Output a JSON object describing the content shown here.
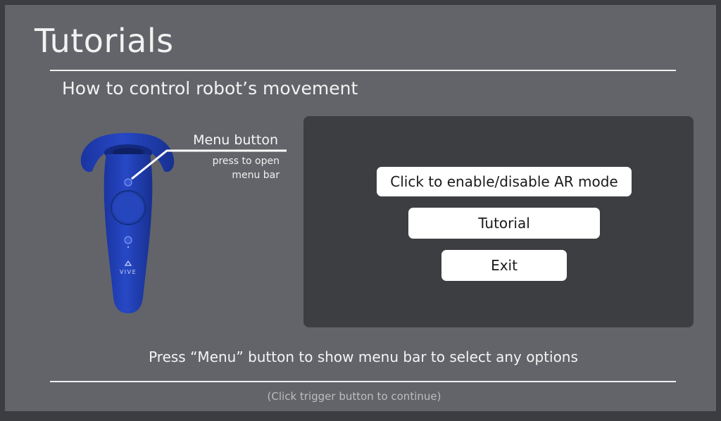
{
  "page": {
    "title": "Tutorials",
    "subtitle": "How to control robot’s movement"
  },
  "controller": {
    "icon": "vive-controller-icon",
    "brand_text": "VIVE",
    "color": "#1f3fb0",
    "menu_label": "Menu button",
    "menu_desc_line1": "press to open",
    "menu_desc_line2": "menu bar"
  },
  "menu": {
    "ar_button_label": "Click to enable/disable AR mode",
    "tutorial_button_label": "Tutorial",
    "exit_button_label": "Exit"
  },
  "footer": {
    "instruction": "Press “Menu” button to show menu bar to select any options",
    "hint": "(Click trigger button to continue)"
  },
  "colors": {
    "background": "#626469",
    "panel": "#3d3e42",
    "button": "#ffffff"
  }
}
